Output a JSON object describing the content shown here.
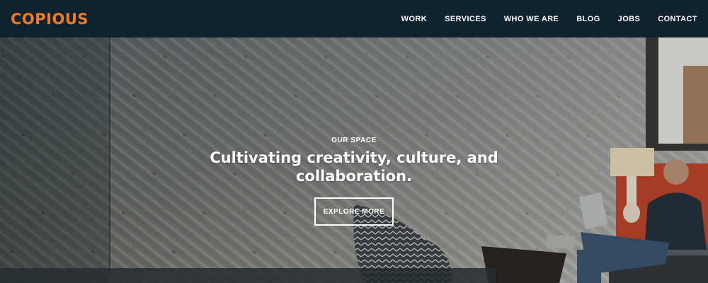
{
  "brand": {
    "logo_text": "COPIOUS",
    "accent_color": "#f47a20",
    "nav_bg": "#0f2230"
  },
  "nav": {
    "items": [
      {
        "label": "WORK"
      },
      {
        "label": "SERVICES"
      },
      {
        "label": "WHO WE ARE"
      },
      {
        "label": "BLOG"
      },
      {
        "label": "JOBS"
      },
      {
        "label": "CONTACT"
      }
    ]
  },
  "hero": {
    "kicker": "OUR SPACE",
    "headline": "Cultivating creativity, culture, and collaboration.",
    "cta_label": "EXPLORE MORE",
    "image_subject": "wood-plank-wall-office-photo"
  }
}
